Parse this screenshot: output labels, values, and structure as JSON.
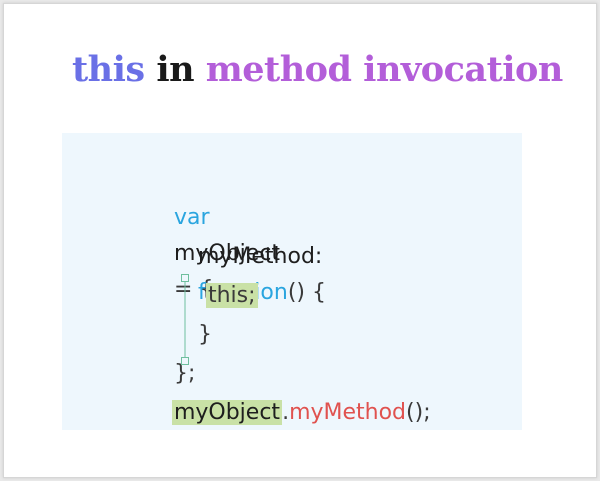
{
  "title": {
    "word1": "this",
    "word2": "in",
    "word3": "method invocation"
  },
  "colors": {
    "title_this": "#6a70e6",
    "title_in": "#1a1a1a",
    "title_method": "#b35ed9",
    "keyword": "#2aa5df",
    "call": "#e0524f",
    "text": "#3a3a3a",
    "highlight": "#c9e1a6",
    "connector": "#6fbf9e"
  },
  "code": {
    "line1": {
      "keyword": "var",
      "ident": "myObject",
      "rest": "= {"
    },
    "line2": {
      "prop": "myMethod:",
      "keyword": "function",
      "rest": "() {"
    },
    "line3": {
      "highlighted": "this;"
    },
    "line4": {
      "text": "}"
    },
    "line5": {
      "text": "};"
    },
    "line6": {
      "object": "myObject",
      "dot": ".",
      "method": "myMethod",
      "rest": "();"
    }
  }
}
